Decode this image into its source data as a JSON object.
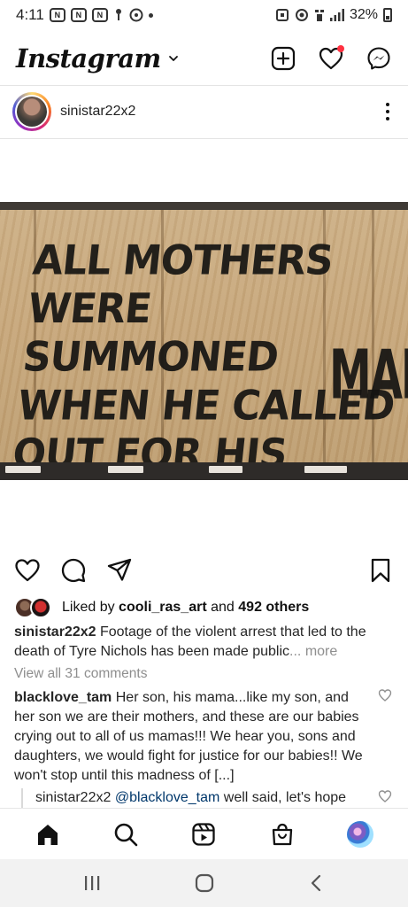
{
  "status_bar": {
    "time": "4:11",
    "battery": "32%",
    "notification_icons": [
      "N",
      "N",
      "N"
    ]
  },
  "header": {
    "logo": "Instagram"
  },
  "post": {
    "username": "sinistar22x2",
    "image_text_lines": [
      "ALL MOTHERS",
      "WERE SUMMONED",
      "WHEN HE CALLED",
      "OUT FOR HIS"
    ],
    "image_text_side": "MAMA",
    "likes": {
      "prefix": "Liked by",
      "user": "cooli_ras_art",
      "middle": "and",
      "others": "492 others"
    },
    "caption": {
      "user": "sinistar22x2",
      "text": "Footage of the violent arrest that led to the death of Tyre Nichols has been made public",
      "ellipsis": "...",
      "more": "more"
    },
    "view_all_comments": "View all 31 comments",
    "comments": [
      {
        "user": "blacklove_tam",
        "text": "Her son, his mama...like my son, and her son we are their mothers, and these are our babies crying out to all of us mamas!!! We hear you, sons and daughters, we would fight for justice for our babies!! We won't stop until this madness of [...]"
      }
    ],
    "reply": {
      "user": "sinistar22x2",
      "mention": "@blacklove_tam",
      "text": "well said, let's hope"
    }
  },
  "colors": {
    "accent_red": "#ff3040",
    "link_blue": "#00376b",
    "muted": "#8e8e8e"
  },
  "icons": {
    "header": [
      "new-post-icon",
      "heart-icon",
      "messenger-icon"
    ],
    "post_actions": [
      "like-icon",
      "comment-icon",
      "share-icon",
      "save-icon"
    ],
    "bottom_nav": [
      "home-icon",
      "search-icon",
      "reels-icon",
      "shop-icon",
      "profile-icon"
    ],
    "system_nav": [
      "recents-icon",
      "home-button-icon",
      "back-icon"
    ]
  }
}
